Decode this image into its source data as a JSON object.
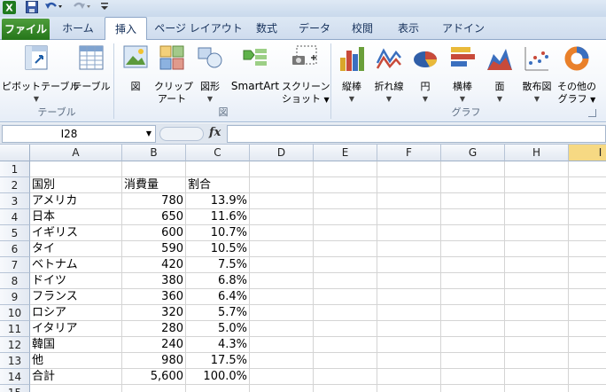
{
  "qat": {
    "app_icon": "excel-logo-icon",
    "save_icon": "save-icon",
    "undo_icon": "undo-icon",
    "redo_icon": "redo-icon",
    "customize_icon": "qat-customize-icon"
  },
  "tabs": [
    "ファイル",
    "ホーム",
    "挿入",
    "ページ レイアウト",
    "数式",
    "データ",
    "校閲",
    "表示",
    "アドイン"
  ],
  "ribbon": {
    "pivot_table": "ピボットテーブル",
    "table": "テーブル",
    "group_table": "テーブル",
    "picture": "図",
    "clipart_1": "クリップ",
    "clipart_2": "アート",
    "shapes": "図形",
    "smartart": "SmartArt",
    "screenshot_1": "スクリーン",
    "screenshot_2": "ショット",
    "group_illustrations": "図",
    "column_chart": "縦棒",
    "line_chart": "折れ線",
    "pie_chart": "円",
    "bar_chart": "横棒",
    "area_chart": "面",
    "scatter_chart": "散布図",
    "other_1": "その他の",
    "other_2": "グラフ",
    "group_charts": "グラフ"
  },
  "formula_bar": {
    "name_box": "I28",
    "fx": "fx",
    "value": ""
  },
  "columns": [
    "A",
    "B",
    "C",
    "D",
    "E",
    "F",
    "G",
    "H",
    "I"
  ],
  "rows": [
    {
      "num": "1",
      "a": "",
      "b": "",
      "c": ""
    },
    {
      "num": "2",
      "a": "国別",
      "b": "消費量",
      "c": "割合"
    },
    {
      "num": "3",
      "a": "アメリカ",
      "b": "780",
      "c": "13.9%"
    },
    {
      "num": "4",
      "a": "日本",
      "b": "650",
      "c": "11.6%"
    },
    {
      "num": "5",
      "a": "イギリス",
      "b": "600",
      "c": "10.7%"
    },
    {
      "num": "6",
      "a": "タイ",
      "b": "590",
      "c": "10.5%"
    },
    {
      "num": "7",
      "a": "ベトナム",
      "b": "420",
      "c": "7.5%"
    },
    {
      "num": "8",
      "a": "ドイツ",
      "b": "380",
      "c": "6.8%"
    },
    {
      "num": "9",
      "a": "フランス",
      "b": "360",
      "c": "6.4%"
    },
    {
      "num": "10",
      "a": "ロシア",
      "b": "320",
      "c": "5.7%"
    },
    {
      "num": "11",
      "a": "イタリア",
      "b": "280",
      "c": "5.0%"
    },
    {
      "num": "12",
      "a": "韓国",
      "b": "240",
      "c": "4.3%"
    },
    {
      "num": "13",
      "a": "他",
      "b": "980",
      "c": "17.5%"
    },
    {
      "num": "14",
      "a": "合計",
      "b": "5,600",
      "c": "100.0%"
    },
    {
      "num": "15",
      "a": "",
      "b": "",
      "c": ""
    }
  ],
  "colors": {
    "file_tab": "#2f8a25",
    "selected_column_header": "#f6d983"
  }
}
